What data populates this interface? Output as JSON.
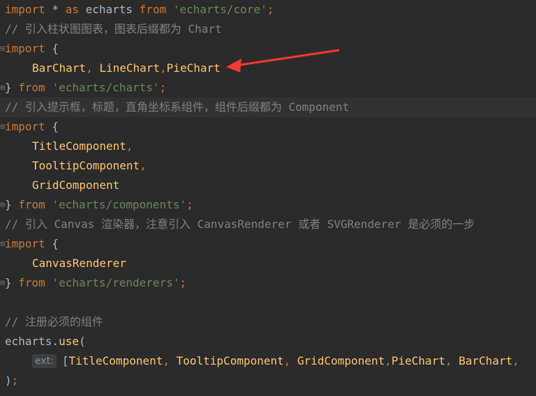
{
  "lines": [
    {
      "indent": false,
      "fold": false,
      "current": false,
      "tokens": [
        {
          "cls": "kw",
          "text": "import"
        },
        {
          "cls": "plain",
          "text": " * "
        },
        {
          "cls": "kw",
          "text": "as"
        },
        {
          "cls": "plain",
          "text": " echarts "
        },
        {
          "cls": "kw",
          "text": "from"
        },
        {
          "cls": "plain",
          "text": " "
        },
        {
          "cls": "str",
          "text": "'echarts/core'"
        },
        {
          "cls": "kw",
          "text": ";"
        }
      ]
    },
    {
      "indent": false,
      "fold": false,
      "current": false,
      "tokens": [
        {
          "cls": "comment",
          "text": "// 引入柱状图图表，图表后缀都为 Chart"
        }
      ]
    },
    {
      "indent": false,
      "fold": true,
      "current": false,
      "tokens": [
        {
          "cls": "kw",
          "text": "import"
        },
        {
          "cls": "plain",
          "text": " {"
        }
      ]
    },
    {
      "indent": true,
      "fold": false,
      "current": false,
      "tokens": [
        {
          "cls": "id",
          "text": "BarChart"
        },
        {
          "cls": "kw",
          "text": ", "
        },
        {
          "cls": "id",
          "text": "LineChart"
        },
        {
          "cls": "kw",
          "text": ","
        },
        {
          "cls": "id",
          "text": "PieChart"
        }
      ]
    },
    {
      "indent": false,
      "fold": true,
      "current": false,
      "tokens": [
        {
          "cls": "plain",
          "text": "} "
        },
        {
          "cls": "kw",
          "text": "from"
        },
        {
          "cls": "plain",
          "text": " "
        },
        {
          "cls": "str",
          "text": "'echarts/charts'"
        },
        {
          "cls": "kw",
          "text": ";"
        }
      ]
    },
    {
      "indent": false,
      "fold": false,
      "current": true,
      "tokens": [
        {
          "cls": "comment",
          "text": "// 引入提示框，标题，直角坐标系组件，组件后缀都为 Component"
        }
      ]
    },
    {
      "indent": false,
      "fold": true,
      "current": false,
      "tokens": [
        {
          "cls": "kw",
          "text": "import"
        },
        {
          "cls": "plain",
          "text": " {"
        }
      ]
    },
    {
      "indent": true,
      "fold": false,
      "current": false,
      "tokens": [
        {
          "cls": "id",
          "text": "TitleComponent"
        },
        {
          "cls": "kw",
          "text": ","
        }
      ]
    },
    {
      "indent": true,
      "fold": false,
      "current": false,
      "tokens": [
        {
          "cls": "id",
          "text": "TooltipComponent"
        },
        {
          "cls": "kw",
          "text": ","
        }
      ]
    },
    {
      "indent": true,
      "fold": false,
      "current": false,
      "tokens": [
        {
          "cls": "id",
          "text": "GridComponent"
        }
      ]
    },
    {
      "indent": false,
      "fold": true,
      "current": false,
      "tokens": [
        {
          "cls": "plain",
          "text": "} "
        },
        {
          "cls": "kw",
          "text": "from"
        },
        {
          "cls": "plain",
          "text": " "
        },
        {
          "cls": "str",
          "text": "'echarts/components'"
        },
        {
          "cls": "kw",
          "text": ";"
        }
      ]
    },
    {
      "indent": false,
      "fold": false,
      "current": false,
      "tokens": [
        {
          "cls": "comment",
          "text": "// 引入 Canvas 渲染器，注意引入 CanvasRenderer 或者 SVGRenderer 是必须的一步"
        }
      ]
    },
    {
      "indent": false,
      "fold": true,
      "current": false,
      "tokens": [
        {
          "cls": "kw",
          "text": "import"
        },
        {
          "cls": "plain",
          "text": " {"
        }
      ]
    },
    {
      "indent": true,
      "fold": false,
      "current": false,
      "tokens": [
        {
          "cls": "id",
          "text": "CanvasRenderer"
        }
      ]
    },
    {
      "indent": false,
      "fold": true,
      "current": false,
      "tokens": [
        {
          "cls": "plain",
          "text": "} "
        },
        {
          "cls": "kw",
          "text": "from"
        },
        {
          "cls": "plain",
          "text": " "
        },
        {
          "cls": "str",
          "text": "'echarts/renderers'"
        },
        {
          "cls": "kw",
          "text": ";"
        }
      ]
    },
    {
      "indent": false,
      "fold": false,
      "current": false,
      "tokens": []
    },
    {
      "indent": false,
      "fold": false,
      "current": false,
      "tokens": [
        {
          "cls": "comment",
          "text": "// 注册必须的组件"
        }
      ]
    },
    {
      "indent": false,
      "fold": false,
      "current": false,
      "tokens": [
        {
          "cls": "plain",
          "text": "echarts."
        },
        {
          "cls": "id",
          "text": "use"
        },
        {
          "cls": "plain",
          "text": "("
        }
      ]
    },
    {
      "indent": true,
      "fold": false,
      "current": false,
      "tokens": [
        {
          "cls": "hint",
          "text": "ext:"
        },
        {
          "cls": "plain",
          "text": "["
        },
        {
          "cls": "id",
          "text": "TitleComponent"
        },
        {
          "cls": "kw",
          "text": ", "
        },
        {
          "cls": "id",
          "text": "TooltipComponent"
        },
        {
          "cls": "kw",
          "text": ", "
        },
        {
          "cls": "id",
          "text": "GridComponent"
        },
        {
          "cls": "kw",
          "text": ","
        },
        {
          "cls": "id",
          "text": "PieChart"
        },
        {
          "cls": "kw",
          "text": ", "
        },
        {
          "cls": "id",
          "text": "BarChart"
        },
        {
          "cls": "kw",
          "text": ","
        }
      ]
    },
    {
      "indent": false,
      "fold": false,
      "current": false,
      "tokens": [
        {
          "cls": "plain",
          "text": ")"
        },
        {
          "cls": "kw",
          "text": ";"
        }
      ]
    }
  ],
  "annotation": {
    "color": "#f03a2e"
  }
}
